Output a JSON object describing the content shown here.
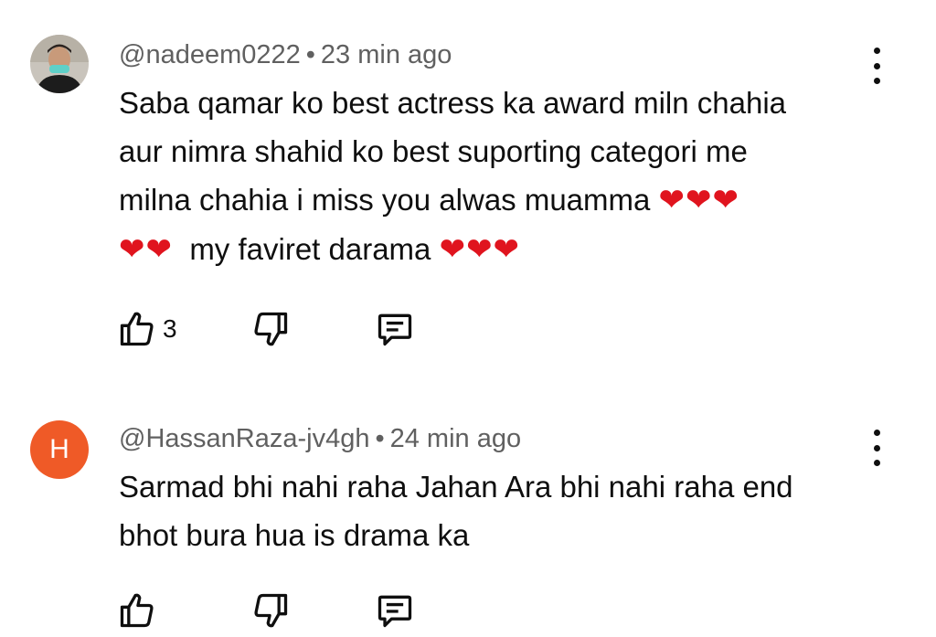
{
  "comments": [
    {
      "username": "@nadeem0222",
      "separator": "•",
      "time": "23 min ago",
      "text_line1": "Saba qamar ko best actress ka award miln chahia",
      "text_line2": "aur nimra shahid ko best suporting categori me",
      "text_line3": "milna chahia i miss you alwas muamma ",
      "hearts_line3": "❤❤❤",
      "hearts_line4_start": "❤❤",
      "text_line4": "  my faviret darama ",
      "hearts_line4_end": "❤❤❤",
      "like_count": "3",
      "avatar_icon": "profile-photo"
    },
    {
      "username": "@HassanRaza-jv4gh",
      "separator": "•",
      "time": "24 min ago",
      "text_line1": "Sarmad bhi nahi raha Jahan Ara bhi nahi raha end",
      "text_line2": "bhot bura hua is drama ka",
      "avatar_letter": "H",
      "avatar_color": "#ef5a27"
    }
  ],
  "icons": {
    "like": "thumbs-up-icon",
    "dislike": "thumbs-down-icon",
    "reply": "reply-icon",
    "more": "more-vertical-icon"
  }
}
